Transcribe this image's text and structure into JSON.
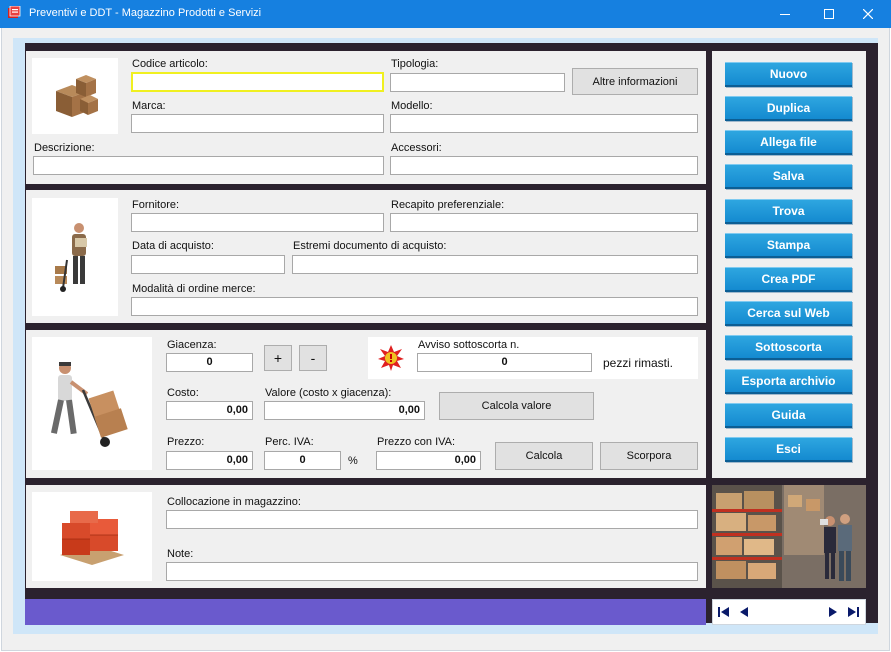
{
  "window": {
    "title": "Preventivi e DDT - Magazzino Prodotti e Servizi"
  },
  "section1": {
    "codice_label": "Codice articolo:",
    "codice_value": "",
    "tipologia_label": "Tipologia:",
    "tipologia_value": "",
    "altre_info_label": "Altre informazioni",
    "marca_label": "Marca:",
    "marca_value": "",
    "modello_label": "Modello:",
    "modello_value": "",
    "descrizione_label": "Descrizione:",
    "descrizione_value": "",
    "accessori_label": "Accessori:",
    "accessori_value": ""
  },
  "section2": {
    "fornitore_label": "Fornitore:",
    "fornitore_value": "",
    "recapito_label": "Recapito preferenziale:",
    "recapito_value": "",
    "data_label": "Data di acquisto:",
    "data_value": "",
    "estremi_label": "Estremi documento di acquisto:",
    "estremi_value": "",
    "modalita_label": "Modalità di ordine merce:",
    "modalita_value": ""
  },
  "section3": {
    "giacenza_label": "Giacenza:",
    "giacenza_value": "0",
    "plus_label": "+",
    "minus_label": "-",
    "avviso_label": "Avviso sottoscorta n.",
    "avviso_value": "0",
    "pezzi_label": "pezzi rimasti.",
    "costo_label": "Costo:",
    "costo_value": "0,00",
    "valore_label": "Valore (costo x giacenza):",
    "valore_value": "0,00",
    "calcola_valore_label": "Calcola valore",
    "prezzo_label": "Prezzo:",
    "prezzo_value": "0,00",
    "iva_label": "Perc. IVA:",
    "iva_value": "0",
    "percent_label": "%",
    "prezzo_iva_label": "Prezzo con IVA:",
    "prezzo_iva_value": "0,00",
    "calcola_label": "Calcola",
    "scorpora_label": "Scorpora"
  },
  "section4": {
    "collocazione_label": "Collocazione in magazzino:",
    "collocazione_value": "",
    "note_label": "Note:",
    "note_value": ""
  },
  "sidebar": {
    "buttons": [
      "Nuovo",
      "Duplica",
      "Allega file",
      "Salva",
      "Trova",
      "Stampa",
      "Crea PDF",
      "Cerca sul Web",
      "Sottoscorta",
      "Esporta archivio",
      "Guida",
      "Esci"
    ]
  },
  "colors": {
    "titlebar": "#1680e0",
    "sidebar_button": "#1a90d4",
    "status_bar": "#6a5acd",
    "frame_dark": "#2b222e"
  }
}
